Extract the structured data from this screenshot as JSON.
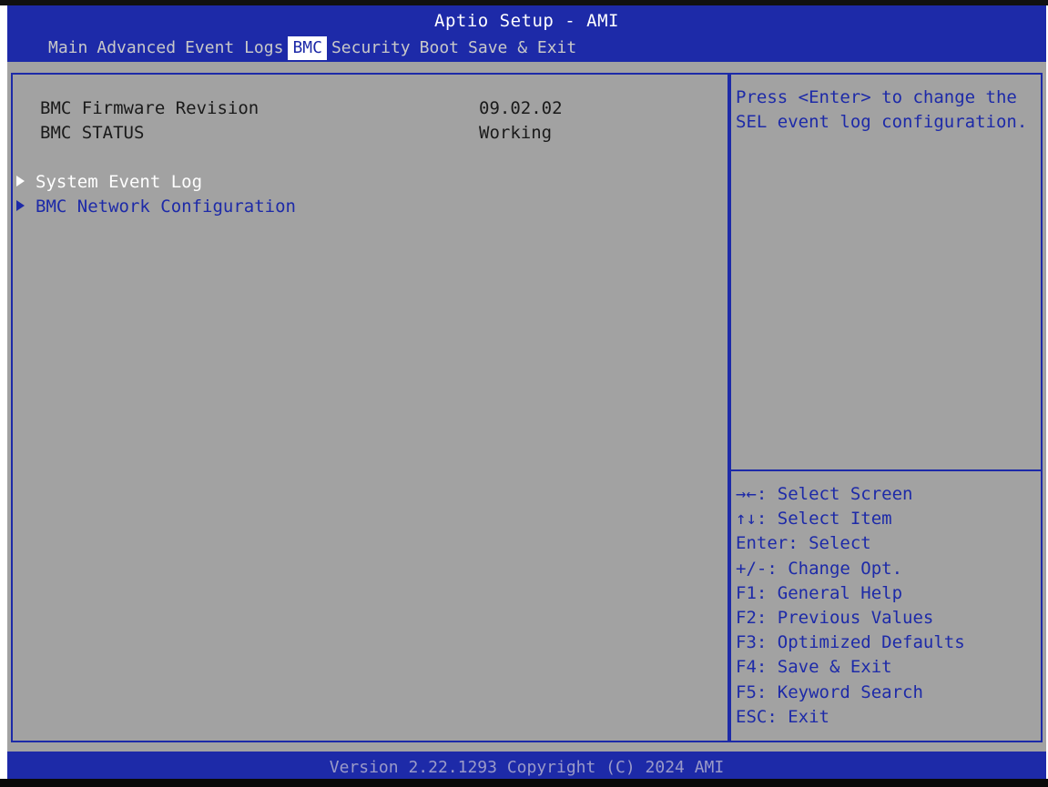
{
  "header": {
    "title": "Aptio Setup - AMI",
    "tabs": [
      {
        "label": "Main"
      },
      {
        "label": "Advanced"
      },
      {
        "label": "Event Logs"
      },
      {
        "label": "BMC"
      },
      {
        "label": "Security"
      },
      {
        "label": "Boot"
      },
      {
        "label": "Save & Exit"
      }
    ],
    "active_tab": "BMC"
  },
  "main": {
    "info_rows": [
      {
        "label": "BMC Firmware Revision",
        "value": "09.02.02"
      },
      {
        "label": "BMC STATUS",
        "value": "Working"
      }
    ],
    "submenus": [
      {
        "label": "System Event Log",
        "selected": true
      },
      {
        "label": "BMC Network Configuration",
        "selected": false
      }
    ]
  },
  "help": {
    "text": "Press <Enter> to change the\nSEL event log configuration."
  },
  "keys": [
    {
      "label": "→←: Select Screen"
    },
    {
      "label": "↑↓: Select Item"
    },
    {
      "label": "Enter: Select"
    },
    {
      "label": "+/-: Change Opt."
    },
    {
      "label": "F1: General Help"
    },
    {
      "label": "F2: Previous Values"
    },
    {
      "label": "F3: Optimized Defaults"
    },
    {
      "label": "F4: Save & Exit"
    },
    {
      "label": "F5: Keyword Search"
    },
    {
      "label": "ESC: Exit"
    }
  ],
  "footer": {
    "text": "Version 2.22.1293 Copyright (C) 2024 AMI"
  },
  "colors": {
    "header_blue": "#1d2aa8",
    "panel_gray": "#a2a2a2",
    "highlight_white": "#ffffff"
  }
}
